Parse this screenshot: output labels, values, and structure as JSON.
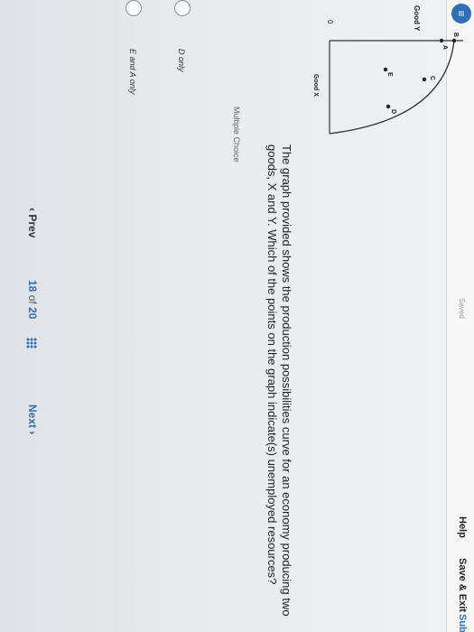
{
  "header": {
    "saved": "Saved",
    "help": "Help",
    "save_exit": "Save & Exit",
    "submit": "Sub"
  },
  "graph": {
    "y_label": "Good Y",
    "x_label": "Good X",
    "origin": "0",
    "points": [
      "B",
      "A",
      "C",
      "E",
      "D"
    ]
  },
  "question": "The graph provided shows the production possibilities curve for an economy producing two goods, X and Y. Which of the points on the graph indicate(s) unemployed resources?",
  "multiple_choice_label": "Multiple Choice",
  "options": [
    "D only",
    "E and A only"
  ],
  "nav": {
    "prev": "Prev",
    "page_current": "18",
    "page_of": "of",
    "page_total": "20",
    "next": "Next"
  },
  "colors": {
    "accent": "#2f6fb6"
  }
}
